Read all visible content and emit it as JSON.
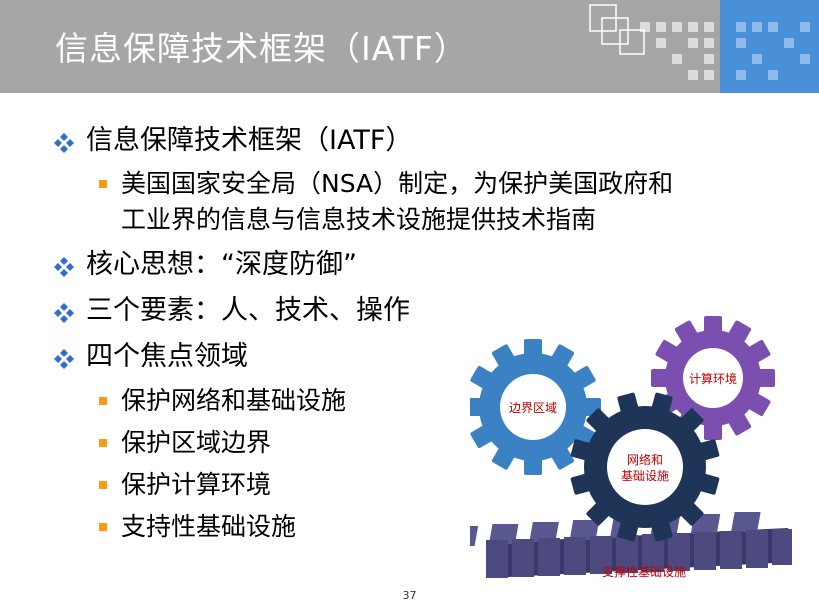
{
  "slide": {
    "title": "信息保障技术框架（IATF）",
    "page_number": "37"
  },
  "outline": {
    "b1": "信息保障技术框架（IATF）",
    "b1_sub1_line1": "美国国家安全局（NSA）制定，为保护美国政府和",
    "b1_sub1_line2": "工业界的信息与信息技术设施提供技术指南",
    "b2": "核心思想：“深度防御”",
    "b3": "三个要素：人、技术、操作",
    "b4": "四个焦点领域",
    "b4_sub1": "保护网络和基础设施",
    "b4_sub2": "保护区域边界",
    "b4_sub3": "保护计算环境",
    "b4_sub4": "支持性基础设施"
  },
  "diagram": {
    "gear_boundary": "边界区域",
    "gear_compute": "计算环境",
    "gear_network_line1": "网络和",
    "gear_network_line2": "基础设施",
    "rack_label": "支撑性基础设施"
  },
  "colors": {
    "title_bar": "#a6a6a6",
    "bullet_diamond": "#2f6fd0",
    "sub_bullet": "#f79b13",
    "gear_boundary": "#3b82c4",
    "gear_network": "#1e3557",
    "gear_compute": "#7a4fb0",
    "rack": "#4c4a7e",
    "label_text": "#c00000"
  },
  "icons": {
    "bullet": "four-diamond-icon",
    "sub_bullet": "orange-square-icon"
  }
}
